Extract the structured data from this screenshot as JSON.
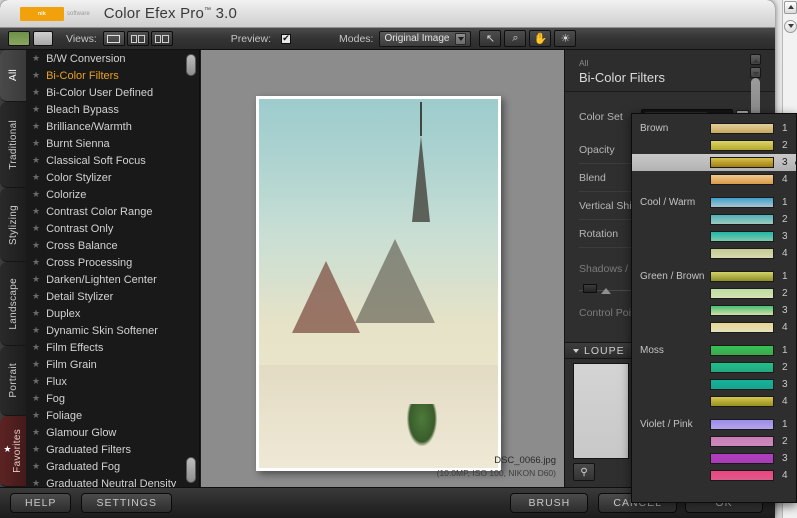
{
  "window": {
    "logo_text": "nik",
    "logo_sub": "software",
    "title": "Color Efex Pro",
    "title_tm": "™",
    "title_version": "3.0"
  },
  "toolbar": {
    "image_view_icon": "image-thumbnail-icon",
    "list_view_icon": "list-view-icon",
    "views_label": "Views:",
    "view_buttons": [
      {
        "name": "single-view",
        "icon": "single-pane-icon"
      },
      {
        "name": "split-view",
        "icon": "split-pane-icon"
      },
      {
        "name": "side-by-side-view",
        "icon": "side-by-side-icon"
      }
    ],
    "preview_label": "Preview:",
    "preview_checked": "✔",
    "modes_label": "Modes:",
    "modes_value": "Original Image",
    "tools": [
      {
        "name": "pointer-tool",
        "glyph": "↖"
      },
      {
        "name": "zoom-tool",
        "glyph": "🔍"
      },
      {
        "name": "pan-hand-tool",
        "glyph": "✋"
      },
      {
        "name": "brightness-tool",
        "glyph": "☀"
      }
    ]
  },
  "categories": [
    {
      "label": "All",
      "active": true
    },
    {
      "label": "Traditional",
      "active": false
    },
    {
      "label": "Stylizing",
      "active": false
    },
    {
      "label": "Landscape",
      "active": false
    },
    {
      "label": "Portrait",
      "active": false
    },
    {
      "label": "Favorites",
      "active": false,
      "favorite": true,
      "star": "★"
    }
  ],
  "filters": [
    {
      "name": "B/W Conversion",
      "selected": false
    },
    {
      "name": "Bi-Color Filters",
      "selected": true
    },
    {
      "name": "Bi-Color User Defined",
      "selected": false
    },
    {
      "name": "Bleach Bypass",
      "selected": false
    },
    {
      "name": "Brilliance/Warmth",
      "selected": false
    },
    {
      "name": "Burnt Sienna",
      "selected": false
    },
    {
      "name": "Classical Soft Focus",
      "selected": false
    },
    {
      "name": "Color Stylizer",
      "selected": false
    },
    {
      "name": "Colorize",
      "selected": false
    },
    {
      "name": "Contrast Color Range",
      "selected": false
    },
    {
      "name": "Contrast Only",
      "selected": false
    },
    {
      "name": "Cross Balance",
      "selected": false
    },
    {
      "name": "Cross Processing",
      "selected": false
    },
    {
      "name": "Darken/Lighten Center",
      "selected": false
    },
    {
      "name": "Detail Stylizer",
      "selected": false
    },
    {
      "name": "Duplex",
      "selected": false
    },
    {
      "name": "Dynamic Skin Softener",
      "selected": false
    },
    {
      "name": "Film Effects",
      "selected": false
    },
    {
      "name": "Film Grain",
      "selected": false
    },
    {
      "name": "Flux",
      "selected": false
    },
    {
      "name": "Fog",
      "selected": false
    },
    {
      "name": "Foliage",
      "selected": false
    },
    {
      "name": "Glamour Glow",
      "selected": false
    },
    {
      "name": "Graduated Filters",
      "selected": false
    },
    {
      "name": "Graduated Fog",
      "selected": false
    },
    {
      "name": "Graduated Neutral Density",
      "selected": false
    }
  ],
  "filter_star": "★",
  "image": {
    "filename": "DSC_0066.jpg",
    "metadata": "(10.0MP, ISO 100, NIKON D60)"
  },
  "panel": {
    "kicker": "All",
    "title": "Bi-Color Filters",
    "color_set_label": "Color Set",
    "color_set_value": "3",
    "color_set_swatch": "#c3a126",
    "controls": [
      {
        "label": "Opacity",
        "dim": false
      },
      {
        "label": "Blend",
        "dim": false
      },
      {
        "label": "Vertical Shift",
        "dim": false
      },
      {
        "label": "Rotation",
        "dim": false
      }
    ],
    "shadows_label": "Shadows / Highlights",
    "control_points_label": "Control Points",
    "loupe_label": "LOUPE",
    "loupe_pin_icon": "pin-icon"
  },
  "dropdown": {
    "groups": [
      {
        "name": "Brown",
        "items": [
          {
            "index": "1",
            "color": "linear-gradient(180deg,#e3cf9a,#c9a95f)",
            "selected": false
          },
          {
            "index": "2",
            "color": "linear-gradient(180deg,#dcd36a,#b5a82c)",
            "selected": false
          },
          {
            "index": "3",
            "color": "linear-gradient(180deg,#d8c04a,#a07d12)",
            "selected": true
          },
          {
            "index": "4",
            "color": "linear-gradient(180deg,#efc98d,#d99b4a)",
            "selected": false
          }
        ]
      },
      {
        "name": "Cool / Warm",
        "items": [
          {
            "index": "1",
            "color": "linear-gradient(180deg,#3f9fcb,#a9c5cf)",
            "selected": false
          },
          {
            "index": "2",
            "color": "linear-gradient(180deg,#4fb2bb,#9fc9bd)",
            "selected": false
          },
          {
            "index": "3",
            "color": "linear-gradient(180deg,#1fb7a8,#7fc9ad)",
            "selected": false
          },
          {
            "index": "4",
            "color": "linear-gradient(180deg,#c2cb8e,#d9d9b2)",
            "selected": false
          }
        ]
      },
      {
        "name": "Green / Brown",
        "items": [
          {
            "index": "1",
            "color": "linear-gradient(180deg,#cfd36a,#8e8f25)",
            "selected": false
          },
          {
            "index": "2",
            "color": "linear-gradient(180deg,#b9dca0,#d7e2b4)",
            "selected": false
          },
          {
            "index": "3",
            "color": "linear-gradient(180deg,#46c072,#d3dfa8)",
            "selected": false
          },
          {
            "index": "4",
            "color": "linear-gradient(180deg,#e8d68f,#e3e0bc)",
            "selected": false
          }
        ]
      },
      {
        "name": "Moss",
        "items": [
          {
            "index": "1",
            "color": "linear-gradient(180deg,#34c257,#3ea84e)",
            "selected": false
          },
          {
            "index": "2",
            "color": "linear-gradient(180deg,#1fc08c,#23a57e)",
            "selected": false
          },
          {
            "index": "3",
            "color": "linear-gradient(180deg,#14b39a,#18a38c)",
            "selected": false
          },
          {
            "index": "4",
            "color": "linear-gradient(180deg,#d4c84f,#9a901f)",
            "selected": false
          }
        ]
      },
      {
        "name": "Violet / Pink",
        "items": [
          {
            "index": "1",
            "color": "linear-gradient(180deg,#9a8ce8,#b6a5ee)",
            "selected": false
          },
          {
            "index": "2",
            "color": "linear-gradient(180deg,#cf7bb5,#c98bbd)",
            "selected": false
          },
          {
            "index": "3",
            "color": "linear-gradient(180deg,#b03fc0,#a93bb5)",
            "selected": false
          },
          {
            "index": "4",
            "color": "linear-gradient(180deg,#e8467f,#e05a8c)",
            "selected": false
          }
        ]
      }
    ]
  },
  "footer": {
    "help": "HELP",
    "settings": "SETTINGS",
    "brush": "BRUSH",
    "cancel": "CANCEL",
    "ok": "OK"
  }
}
